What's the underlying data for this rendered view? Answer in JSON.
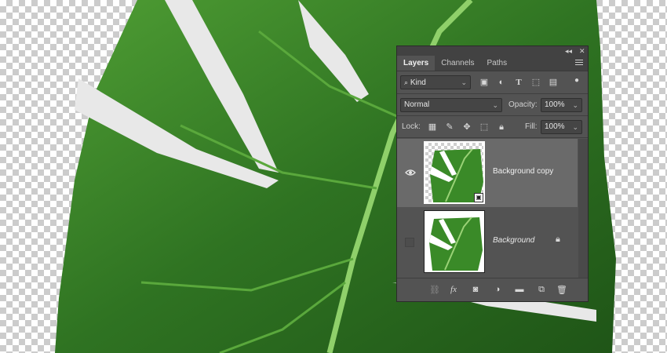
{
  "panel": {
    "tabs": [
      {
        "label": "Layers",
        "active": true
      },
      {
        "label": "Channels",
        "active": false
      },
      {
        "label": "Paths",
        "active": false
      }
    ],
    "collapse_glyph": "◂◂",
    "close_glyph": "✕",
    "filter": {
      "kind_label": "Kind"
    },
    "blend_mode": "Normal",
    "opacity_label": "Opacity:",
    "opacity_value": "100%",
    "lock_label": "Lock:",
    "fill_label": "Fill:",
    "fill_value": "100%",
    "layers": [
      {
        "name": "Background copy",
        "visible": true,
        "selected": true,
        "smart_object": true,
        "locked": false
      },
      {
        "name": "Background",
        "visible": false,
        "selected": false,
        "smart_object": false,
        "locked": true
      }
    ],
    "bottom_icons": [
      "link-icon",
      "fx-icon",
      "mask-icon",
      "adjustment-icon",
      "folder-icon",
      "new-layer-icon",
      "trash-icon"
    ],
    "fx_label": "fx"
  },
  "colors": {
    "leaf_dark": "#2c6a1f",
    "leaf_mid": "#3f8f2c",
    "leaf_light": "#6cb84a",
    "panel_bg": "#535353",
    "selected_row": "#6a6a6a"
  }
}
